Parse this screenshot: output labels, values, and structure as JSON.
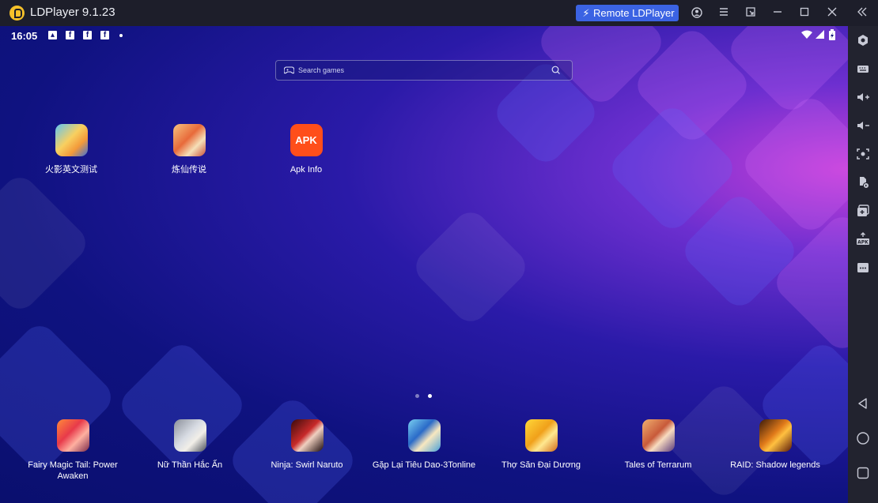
{
  "window": {
    "title": "LDPlayer 9.1.23",
    "remote_label": "Remote LDPlayer",
    "icons": [
      "account-icon",
      "menu-icon",
      "picture-in-picture-icon",
      "minimize-icon",
      "maximize-icon",
      "close-icon",
      "collapse-sidebar-icon"
    ]
  },
  "status": {
    "time": "16:05",
    "notification_icons": [
      "image-icon",
      "facebook-icon",
      "facebook-icon",
      "facebook-icon",
      "more-dot-icon"
    ],
    "system_icons": [
      "wifi-icon",
      "signal-icon",
      "battery-charging-icon"
    ]
  },
  "search": {
    "placeholder": "Search games"
  },
  "home_apps": [
    {
      "label": "火影英文测试",
      "icon": "naruto-test-app-icon"
    },
    {
      "label": "炼仙传说",
      "icon": "lianxian-app-icon"
    },
    {
      "label": "Apk Info",
      "icon": "apk-info-icon",
      "icon_text": "APK"
    }
  ],
  "page_indicator": {
    "pages": 2,
    "current": 2
  },
  "dock_apps": [
    {
      "label": "Fairy Magic Tail: Power Awaken"
    },
    {
      "label": "Nữ Thần Hắc Ấn"
    },
    {
      "label": "Ninja: Swirl Naruto"
    },
    {
      "label": "Gặp Lại Tiêu Dao-3Tonline"
    },
    {
      "label": "Thợ Săn Đại Dương"
    },
    {
      "label": "Tales of Terrarum"
    },
    {
      "label": "RAID: Shadow legends"
    }
  ],
  "sidebar": {
    "tools": [
      "settings-icon",
      "keyboard-mapping-icon",
      "volume-up-icon",
      "volume-down-icon",
      "screenshot-icon",
      "record-icon",
      "multi-instance-icon",
      "install-apk-icon",
      "more-icon"
    ],
    "nav": [
      "back-icon",
      "home-icon",
      "recents-icon"
    ]
  },
  "colors": {
    "accent": "#3b63e3",
    "titlebar": "#1d1e2a",
    "sidebar": "#22232f",
    "apk": "#ff4e1a"
  }
}
